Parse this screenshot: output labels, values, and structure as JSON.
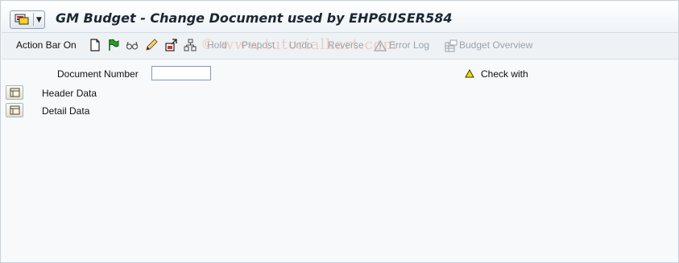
{
  "title": "GM Budget - Change Document used by EHP6USER584",
  "toolbar": {
    "action_bar": "Action Bar On",
    "hold": "Hold",
    "prepost": "Prepost",
    "undo": "Undo",
    "reverse": "Reverse",
    "error_log": "Error Log",
    "budget_overview": "Budget Overview"
  },
  "watermark": "© www.tutorialkart.com",
  "form": {
    "document_number_label": "Document Number",
    "document_number_value": "",
    "check_with_label": "Check with"
  },
  "sections": {
    "header": "Header  Data",
    "detail": "Detail  Data"
  },
  "icons": {
    "new": "new-document-icon",
    "flag": "flag-icon",
    "glasses": "display-glasses-icon",
    "pencil": "pencil-icon",
    "import": "import-icon",
    "hierarchy": "hierarchy-icon",
    "warning": "warning-triangle-icon"
  },
  "colors": {
    "warning_yellow": "#f5d800",
    "disabled_text": "#9aa3ab"
  }
}
